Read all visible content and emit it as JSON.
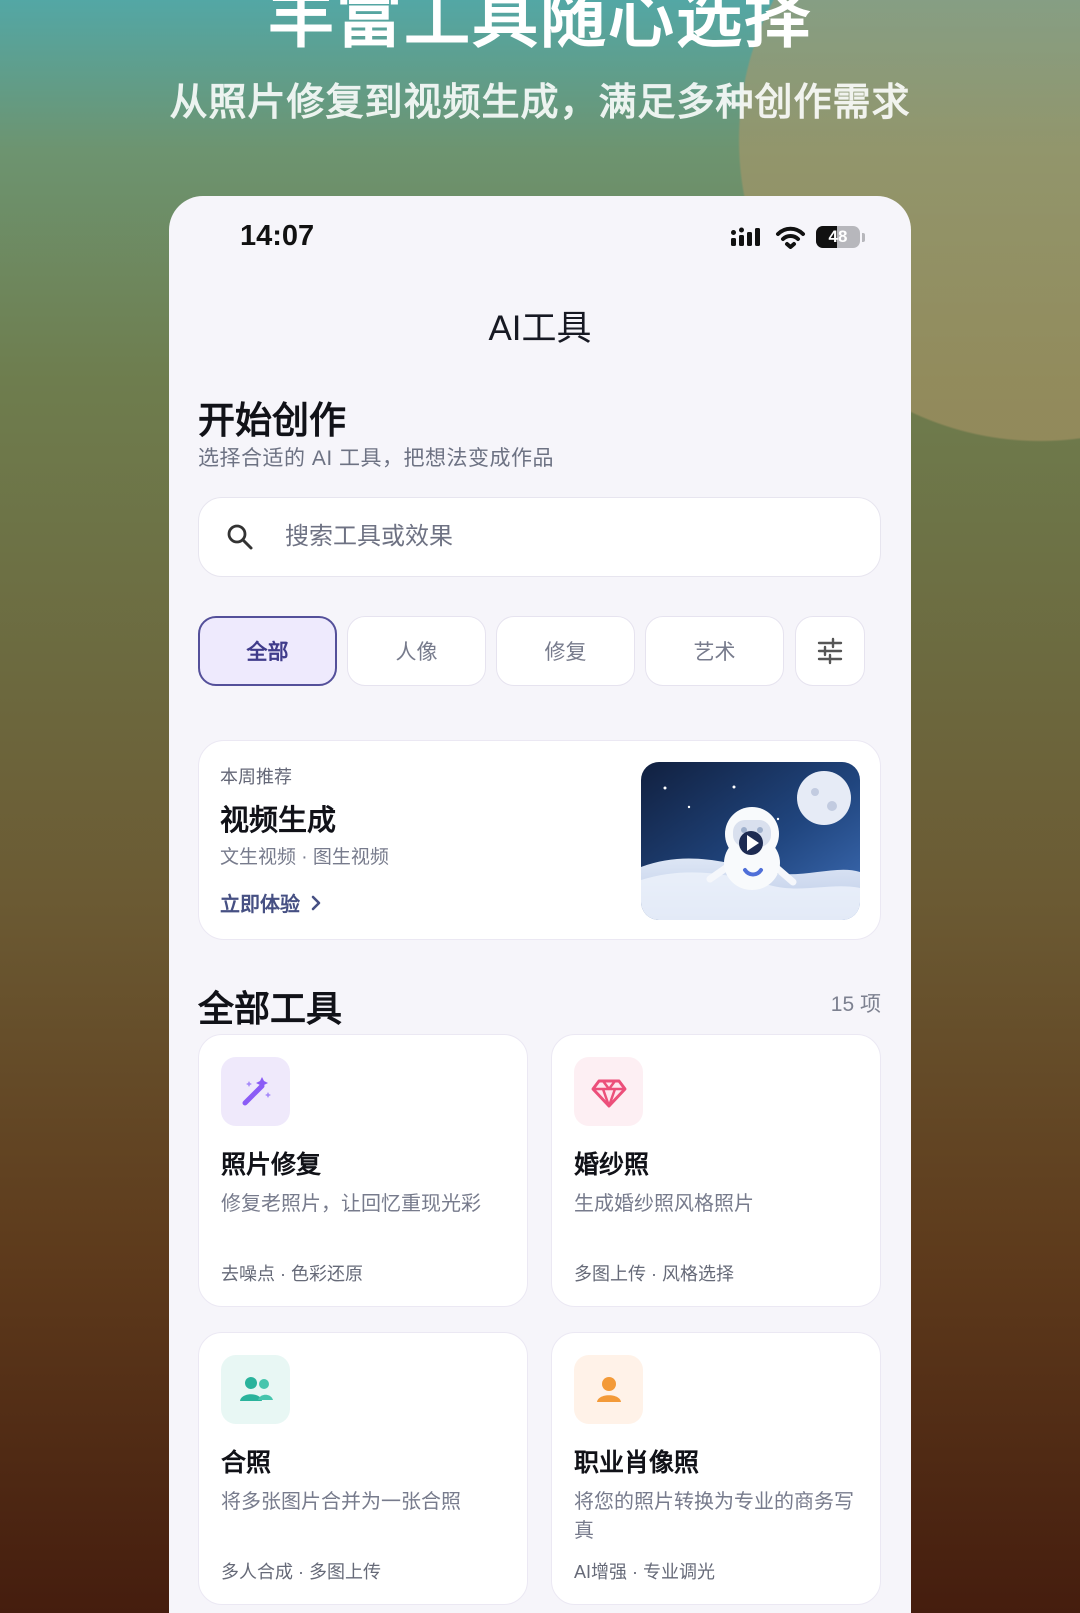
{
  "hero": {
    "title": "丰富工具随心选择",
    "subtitle": "从照片修复到视频生成，满足多种创作需求"
  },
  "status": {
    "time": "14:07",
    "battery": "48",
    "icons": [
      "signal-icon",
      "wifi-icon",
      "battery-icon"
    ]
  },
  "nav": {
    "title": "AI工具"
  },
  "intro": {
    "title": "开始创作",
    "subtitle": "选择合适的 AI 工具，把想法变成作品"
  },
  "search": {
    "placeholder": "搜索工具或效果",
    "icon": "search-icon"
  },
  "filters": [
    {
      "label": "全部",
      "active": true
    },
    {
      "label": "人像",
      "active": false
    },
    {
      "label": "修复",
      "active": false
    },
    {
      "label": "艺术",
      "active": false
    }
  ],
  "filter_settings_icon": "sliders-icon",
  "featured": {
    "eyebrow": "本周推荐",
    "title": "视频生成",
    "meta": "文生视频 · 图生视频",
    "cta": "立即体验",
    "image": "astronaut-video-illustration"
  },
  "all_tools": {
    "title": "全部工具",
    "count": "15 项",
    "items": [
      {
        "title": "照片修复",
        "description": "修复老照片，让回忆重现光彩",
        "tags": "去噪点 · 色彩还原",
        "icon": "magic-wand-icon",
        "icon_bg": "#efe9fb",
        "icon_color": "#8b5cf6"
      },
      {
        "title": "婚纱照",
        "description": "生成婚纱照风格照片",
        "tags": "多图上传 · 风格选择",
        "icon": "diamond-icon",
        "icon_bg": "#fdeff3",
        "icon_color": "#ec4f7a"
      },
      {
        "title": "合照",
        "description": "将多张图片合并为一张合照",
        "tags": "多人合成 · 多图上传",
        "icon": "group-people-icon",
        "icon_bg": "#e8f7f4",
        "icon_color": "#2ab39c"
      },
      {
        "title": "职业肖像照",
        "description": "将您的照片转换为专业的商务写真",
        "tags": "AI增强 · 专业调光",
        "icon": "person-icon",
        "icon_bg": "#fff2e8",
        "icon_color": "#f39a38"
      }
    ]
  },
  "colors": {
    "primary": "#54509a",
    "active_chip_bg": "#eeeafd",
    "page_bg": "#f6f5fa"
  }
}
